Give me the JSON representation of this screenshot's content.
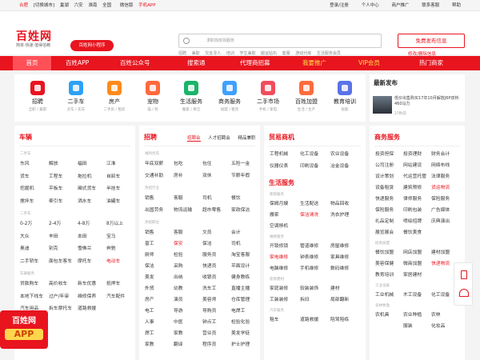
{
  "topbar": {
    "city": "合肥",
    "switch": "[切换城市]",
    "cities": [
      "巢湖",
      "六安",
      "淮南",
      "全国"
    ],
    "wechat": "微信版",
    "mobile": "手机APP",
    "right": [
      "登录/注册",
      "个人中心",
      "商户推广",
      "联系客服",
      "帮助"
    ]
  },
  "logo": {
    "title": "百姓网",
    "slogan": "简单·快速·值得信赖",
    "mini_label": "百姓网小程序"
  },
  "search": {
    "placeholder": "求职找房找服务",
    "hotwords": [
      "招聘",
      "兼职",
      "交友寻人",
      "培训",
      "学生兼职",
      "搬运钻石",
      "客服",
      "游戏代练",
      "生活服务会员"
    ]
  },
  "post": {
    "button": "免费发布信息",
    "sub": "修改/删除信息"
  },
  "nav": {
    "items": [
      "首页",
      "百姓APP",
      "百姓公众号",
      "搜索通",
      "代理商招募",
      "我要推广",
      "VIP会员",
      "热门商家"
    ]
  },
  "categories": [
    {
      "name": "招聘",
      "sub": "全职 / 兼职",
      "color": "#e8141e"
    },
    {
      "name": "二手车",
      "sub": "买车 / 卖车",
      "color": "#2da1f5"
    },
    {
      "name": "房产",
      "sub": "二手房 / 租房",
      "color": "#ff8a1a"
    },
    {
      "name": "宠物",
      "sub": "猫 / 狗",
      "color": "#ff6a3d"
    },
    {
      "name": "生活服务",
      "sub": "搬家 / 保洁",
      "color": "#19b46a"
    },
    {
      "name": "商务服务",
      "sub": "加盟 / 租赁",
      "color": "#3fa0ff"
    },
    {
      "name": "二手市场",
      "sub": "手机 / 家电",
      "color": "#f04d5b"
    },
    {
      "name": "百姓加盟",
      "sub": "生活 / 生产",
      "color": "#ff6b3d"
    },
    {
      "name": "教育培训",
      "sub": "技能",
      "color": "#5a73e6"
    }
  ],
  "latest": {
    "heading": "最新发布",
    "text": "低价出售购买17年10月解放J6P双桥460马力",
    "time": "27秒前"
  },
  "cheliang": {
    "heading": "车辆",
    "group1": "二手车",
    "rows1": [
      [
        "东风",
        "解放",
        "福田",
        "江淮"
      ],
      [
        "货车",
        "工程车",
        "拖拉机",
        "自卸车"
      ],
      [
        "挖掘机",
        "平板车",
        "厢式货车",
        "半挂车"
      ],
      [
        "搅拌车",
        "牵引车",
        "洒水车",
        "油罐车"
      ]
    ],
    "group2": "二手车",
    "rows2": [
      [
        "0-2万",
        "2-4万",
        "4-8万",
        "8万以上"
      ],
      [
        "大众",
        "丰田",
        "本田",
        "宝马"
      ],
      [
        "奥迪",
        "别克",
        "雪佛兰",
        "奔驰"
      ],
      [
        "二手轿车",
        "面包车客车",
        "摩托车",
        "电动车"
      ]
    ],
    "group3": "车辆服务",
    "rows3": [
      [
        "贷款购车",
        "高价收车",
        "新车优惠",
        "抵押车"
      ],
      [
        "本地下线车",
        "过户/年审",
        "维修保养",
        "汽车配件"
      ],
      [
        "汽车用品",
        "拆车摩托车",
        "道路救援"
      ]
    ]
  },
  "zhaopin": {
    "heading": "招聘",
    "tabs": [
      "招聘会",
      "人才招聘会",
      "精品兼职"
    ],
    "group1": "福利优先",
    "rows1": [
      [
        "年底双薪",
        "包吃",
        "包住",
        "五险一金"
      ],
      [
        "交通补助",
        "房补",
        "双休",
        "节薪年假"
      ]
    ],
    "group2": "热招行业",
    "rows2": [
      [
        "销售",
        "客服",
        "司机",
        "餐饮"
      ],
      [
        "出国劳务",
        "物流运输",
        "超市零售",
        "家政保洁"
      ]
    ],
    "group3": "热招职位",
    "rows3": [
      [
        "销售",
        "客服",
        "文员",
        "会计"
      ],
      [
        "普工",
        "保安",
        "保洁",
        "司机"
      ],
      [
        "厨师",
        "检验",
        "服务员",
        "淘宝客服"
      ],
      [
        "保洁",
        "采购",
        "快递员",
        "平面设计"
      ],
      [
        "美发",
        "出纳",
        "收银员",
        "健身教练"
      ],
      [
        "外贸",
        "幼教",
        "洗车工",
        "直播主播"
      ],
      [
        "房产",
        "演员",
        "美容师",
        "仓库管理"
      ],
      [
        "电工",
        "导游",
        "导购员",
        "电焊工"
      ],
      [
        "人事",
        "中医",
        "钟点工",
        "检验化验"
      ],
      [
        "焊工",
        "家教",
        "营业员",
        "美发学徒"
      ],
      [
        "家教",
        "翻译",
        "程序员",
        "护士护理"
      ]
    ]
  },
  "shangmao": {
    "heading": "贸易商机",
    "rows1": [
      [
        "工程机械",
        "化工设备",
        "农业设备"
      ],
      [
        "仪器仪表",
        "印刷设备",
        "冶金设备"
      ]
    ],
    "heading2": "生活服务",
    "group": "家政服务",
    "rows2": [
      [
        "保姆月嫂",
        "生活配送",
        "物品回收"
      ],
      [
        "搬家",
        "保洁清洗",
        "洗衣护理"
      ],
      [
        "空调移机"
      ]
    ],
    "group2": "维修服务",
    "rows3": [
      [
        "开锁修锁",
        "管道维修",
        "房屋维修"
      ],
      [
        "家电维修",
        "钟表维修",
        "家具维修"
      ],
      [
        "电脑维修",
        "手机维修",
        "数码维修"
      ]
    ],
    "group3": "装修建材",
    "rows4": [
      [
        "家庭装修",
        "软装装饰",
        "建材"
      ],
      [
        "工装装修",
        "拆旧",
        "局部翻新"
      ]
    ],
    "group4": "汽车服务",
    "rows5": [
      [
        "租车",
        "道路救援",
        "陪驾陪练"
      ]
    ]
  },
  "shangwu": {
    "heading": "商务服务",
    "rows1": [
      [
        "投资担保",
        "投资理财",
        "财务会计"
      ],
      [
        "公司注册",
        "网站建设",
        "网络布线"
      ],
      [
        "设计策划",
        "代运营托管",
        "法律服务"
      ],
      [
        "设备租赁",
        "建筑预修",
        "货运物流"
      ],
      [
        "快递服务",
        "律师服务",
        "保险服务"
      ],
      [
        "保险服务",
        "印刷包装",
        "广告媒体"
      ],
      [
        "礼品定制",
        "喷绘招牌",
        "庆典演出"
      ],
      [
        "展览展会",
        "餐饮美食"
      ]
    ],
    "group": "招商加盟",
    "rows2": [
      [
        "餐饮加盟",
        "网店加盟",
        "建材加盟"
      ],
      [
        "美容保健",
        "微商加盟",
        "快递物流"
      ],
      [
        "教育培训",
        "家居建材"
      ]
    ],
    "group2": "工业设备",
    "rows3": [
      [
        "工业机械",
        "木工设备",
        "化工设备"
      ]
    ],
    "group3": "农林牧渔",
    "rows4": [
      [
        "农机具",
        "农业种植",
        "农林"
      ],
      [
        "",
        "服装",
        "化妆品"
      ]
    ]
  },
  "app_ad": {
    "a": "百姓网",
    "b": "APP"
  },
  "bottom_strip": "段发布商  找发布商  二手房"
}
